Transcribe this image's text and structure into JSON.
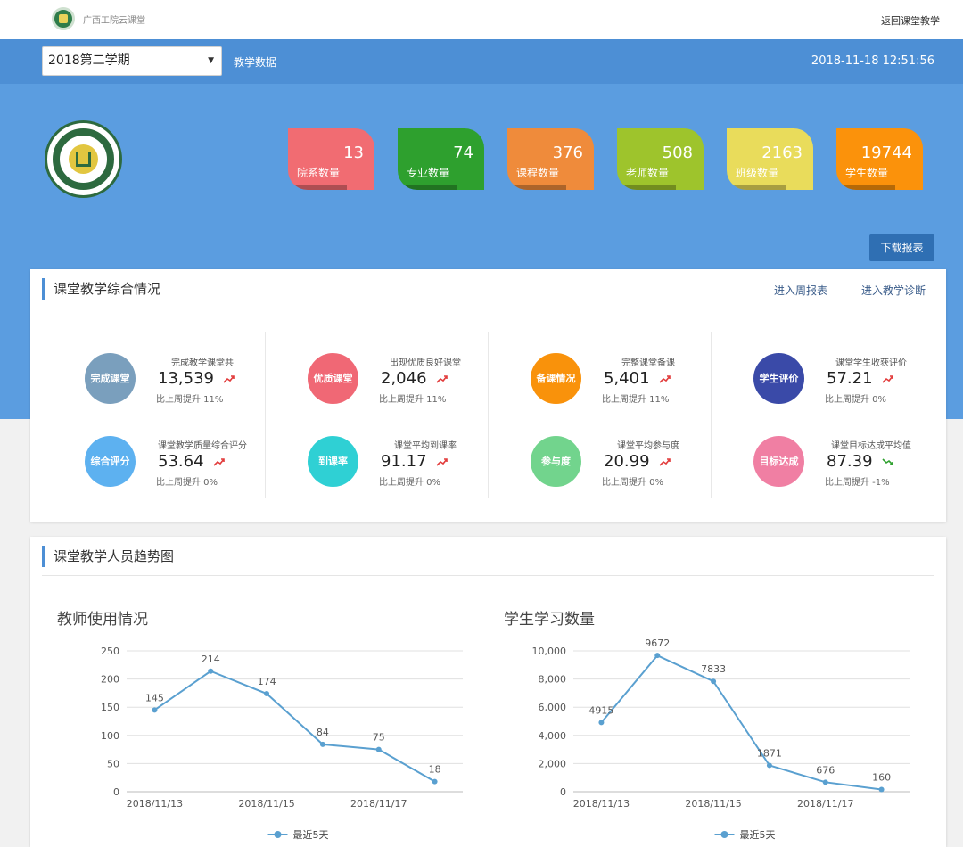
{
  "header": {
    "brand": "广西工院云课堂",
    "return_link": "返回课堂教学"
  },
  "nav": {
    "semester": "2018第二学期",
    "title": "教学数据",
    "datetime": "2018-11-18 12:51:56"
  },
  "stats": [
    {
      "value": "13",
      "label": "院系数量",
      "color": "#f16c72"
    },
    {
      "value": "74",
      "label": "专业数量",
      "color": "#2ea02e"
    },
    {
      "value": "376",
      "label": "课程数量",
      "color": "#ef8b3b"
    },
    {
      "value": "508",
      "label": "老师数量",
      "color": "#9ec42c"
    },
    {
      "value": "2163",
      "label": "班级数量",
      "color": "#e9dc5b"
    },
    {
      "value": "19744",
      "label": "学生数量",
      "color": "#fb920b"
    }
  ],
  "download_label": "下载报表",
  "overview": {
    "title": "课堂教学综合情况",
    "link_weekly": "进入周报表",
    "link_diagnosis": "进入教学诊断",
    "metrics": [
      {
        "badge": "完成课堂",
        "title": "完成教学课堂共",
        "value": "13,539",
        "change": "比上周提升  11%",
        "color": "#7a9fbd",
        "trend": "up"
      },
      {
        "badge": "优质课堂",
        "title": "出现优质良好课堂",
        "value": "2,046",
        "change": "比上周提升  11%",
        "color": "#f06875",
        "trend": "up"
      },
      {
        "badge": "备课情况",
        "title": "完整课堂备课",
        "value": "5,401",
        "change": "比上周提升  11%",
        "color": "#f9920b",
        "trend": "up"
      },
      {
        "badge": "学生评价",
        "title": "课堂学生收获评价",
        "value": "57.21",
        "change": "比上周提升  0%",
        "color": "#3a4aa8",
        "trend": "up"
      },
      {
        "badge": "综合评分",
        "title": "课堂教学质量综合评分",
        "value": "53.64",
        "change": "比上周提升  0%",
        "color": "#5db1f0",
        "trend": "up"
      },
      {
        "badge": "到课率",
        "title": "课堂平均到课率",
        "value": "91.17",
        "change": "比上周提升  0%",
        "color": "#2fd0d4",
        "trend": "up"
      },
      {
        "badge": "参与度",
        "title": "课堂平均参与度",
        "value": "20.99",
        "change": "比上周提升  0%",
        "color": "#72d48d",
        "trend": "up"
      },
      {
        "badge": "目标达成",
        "title": "课堂目标达成平均值",
        "value": "87.39",
        "change": "比上周提升  -1%",
        "color": "#f07fa3",
        "trend": "down"
      }
    ]
  },
  "trend_panel": {
    "title": "课堂教学人员趋势图"
  },
  "chart_data": [
    {
      "type": "line",
      "title": "教师使用情况",
      "x": [
        "2018/11/13",
        "2018/11/14",
        "2018/11/15",
        "2018/11/16",
        "2018/11/17",
        "2018/11/18"
      ],
      "x_tick_labels": [
        "2018/11/13",
        "2018/11/15",
        "2018/11/17"
      ],
      "y_ticks": [
        "0",
        "50",
        "100",
        "150",
        "200",
        "250"
      ],
      "series": [
        {
          "name": "最近5天",
          "values": [
            145,
            214,
            174,
            84,
            75,
            18
          ]
        }
      ],
      "ylim": [
        0,
        250
      ],
      "grid": true,
      "legend": "bottom-center",
      "line_color": "#5aa0d0"
    },
    {
      "type": "line",
      "title": "学生学习数量",
      "x": [
        "2018/11/13",
        "2018/11/14",
        "2018/11/15",
        "2018/11/16",
        "2018/11/17",
        "2018/11/18"
      ],
      "x_tick_labels": [
        "2018/11/13",
        "2018/11/15",
        "2018/11/17"
      ],
      "y_ticks": [
        "0",
        "2,000",
        "4,000",
        "6,000",
        "8,000",
        "10,000"
      ],
      "series": [
        {
          "name": "最近5天",
          "values": [
            4915,
            9672,
            7833,
            1871,
            676,
            160
          ]
        }
      ],
      "ylim": [
        0,
        10000
      ],
      "grid": true,
      "legend": "bottom-center",
      "line_color": "#5aa0d0"
    }
  ]
}
